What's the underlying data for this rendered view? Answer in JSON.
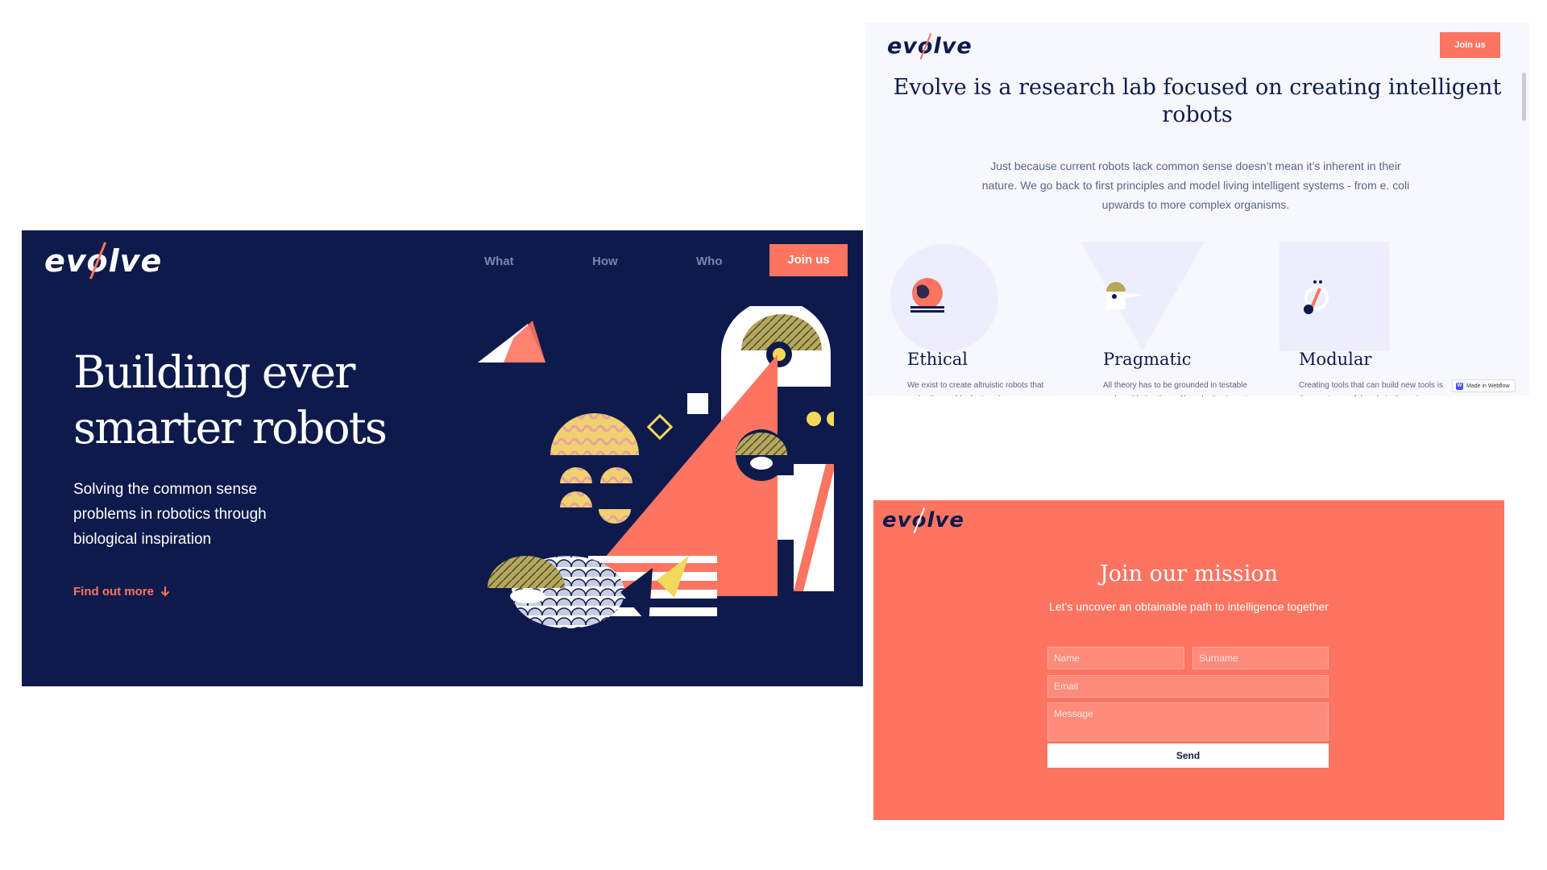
{
  "hero": {
    "logo": "evolve",
    "nav": [
      "What",
      "How",
      "Who"
    ],
    "join_label": "Join us",
    "title": "Building ever smarter robots",
    "subtitle": "Solving the common sense problems in robotics through biological inspiration",
    "find_more": "Find out more",
    "find_more_icon": "arrow-down-icon",
    "colors": {
      "background": "#0e1a4b",
      "accent": "#fd7461",
      "yellow": "#f4d85d"
    }
  },
  "about": {
    "logo": "evolve",
    "join_label": "Join us",
    "title": "Evolve is a research lab focused on creating intelligent robots",
    "text": "Just because current robots lack common sense doesn’t mean it’s inherent in their nature. We go back to first principles and model living intelligent systems - from e. coli upwards to more complex organisms.",
    "features": [
      {
        "title": "Ethical",
        "text": "We exist to create altruistic robots that make the world a better place."
      },
      {
        "title": "Pragmatic",
        "text": "All theory has to be grounded in testable real-world situations. Also, don’t reinvent the wheel."
      },
      {
        "title": "Modular",
        "text": "Creating tools that can build new tools is the most powerful cycle in the universe."
      }
    ],
    "badge": "Made in Webflow"
  },
  "join": {
    "logo": "evolve",
    "title": "Join our mission",
    "subtitle": "Let’s uncover an obtainable path to intelligence together",
    "placeholders": {
      "name": "Name",
      "surname": "Surname",
      "email": "Email",
      "message": "Message"
    },
    "send_label": "Send"
  }
}
